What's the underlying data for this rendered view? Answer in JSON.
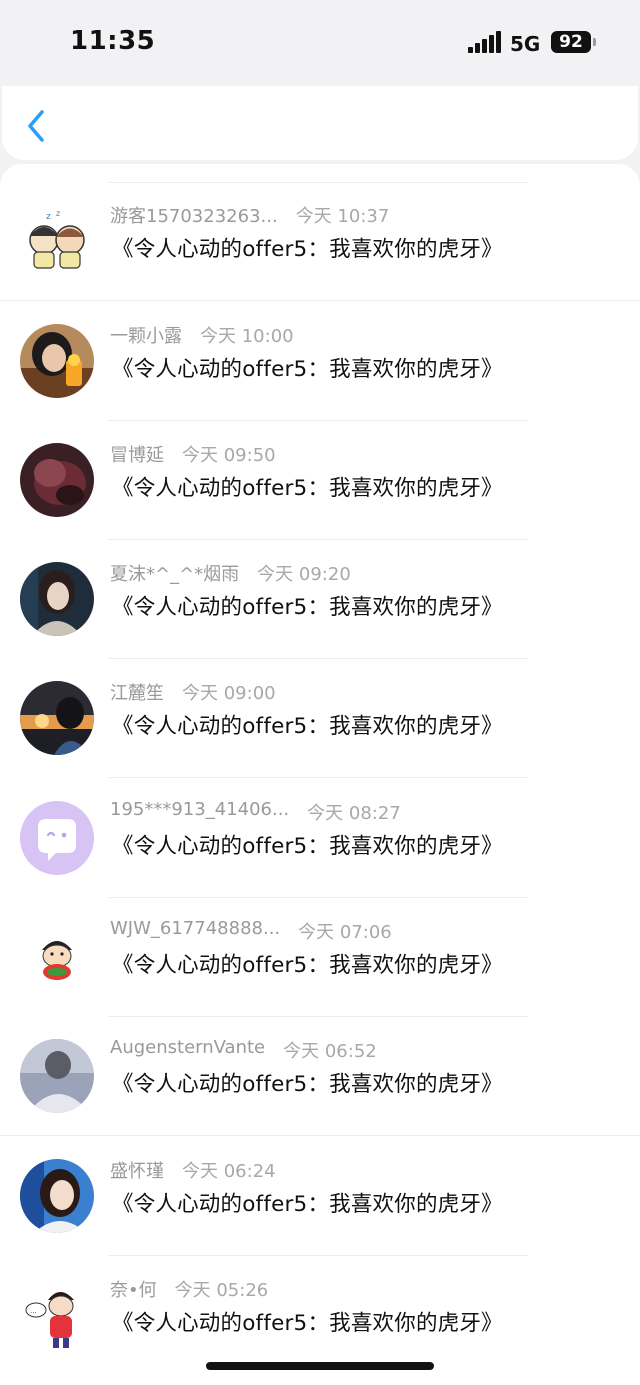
{
  "status_bar": {
    "time": "11:35",
    "network": "5G",
    "battery": "92"
  },
  "nav": {
    "back_icon": "chevron-left-icon",
    "accent": "#2a9df4"
  },
  "messages": [
    {
      "name": "游客1570323263...",
      "time": "今天 10:37",
      "text": "《令人心动的offer5：我喜欢你的虎牙》",
      "avatar": "cartoon-couple"
    },
    {
      "name": "一颗小露",
      "time": "今天 10:00",
      "text": "《令人心动的offer5：我喜欢你的虎牙》",
      "avatar": "photo-girl-drink"
    },
    {
      "name": "冒博延",
      "time": "今天 09:50",
      "text": "《令人心动的offer5：我喜欢你的虎牙》",
      "avatar": "photo-dark-red"
    },
    {
      "name": "夏沫*^_^*烟雨",
      "time": "今天 09:20",
      "text": "《令人心动的offer5：我喜欢你的虎牙》",
      "avatar": "photo-girl-scarf"
    },
    {
      "name": "江麓笙",
      "time": "今天 09:00",
      "text": "《令人心动的offer5：我喜欢你的虎牙》",
      "avatar": "photo-sunset-boy"
    },
    {
      "name": "195***913_41406...",
      "time": "今天 08:27",
      "text": "《令人心动的offer5：我喜欢你的虎牙》",
      "avatar": "default-purple-chat"
    },
    {
      "name": "WJW_617748888...",
      "time": "今天 07:06",
      "text": "《令人心动的offer5：我喜欢你的虎牙》",
      "avatar": "cartoon-crayon-boy"
    },
    {
      "name": "AugensternVante",
      "time": "今天 06:52",
      "text": "《令人心动的offer5：我喜欢你的虎牙》",
      "avatar": "photo-hooded-figure"
    },
    {
      "name": "盛怀瑾",
      "time": "今天 06:24",
      "text": "《令人心动的offer5：我喜欢你的虎牙》",
      "avatar": "photo-girl-blue"
    },
    {
      "name": "奈•何",
      "time": "今天 05:26",
      "text": "《令人心动的offer5：我喜欢你的虎牙》",
      "avatar": "cartoon-red-boy"
    }
  ]
}
